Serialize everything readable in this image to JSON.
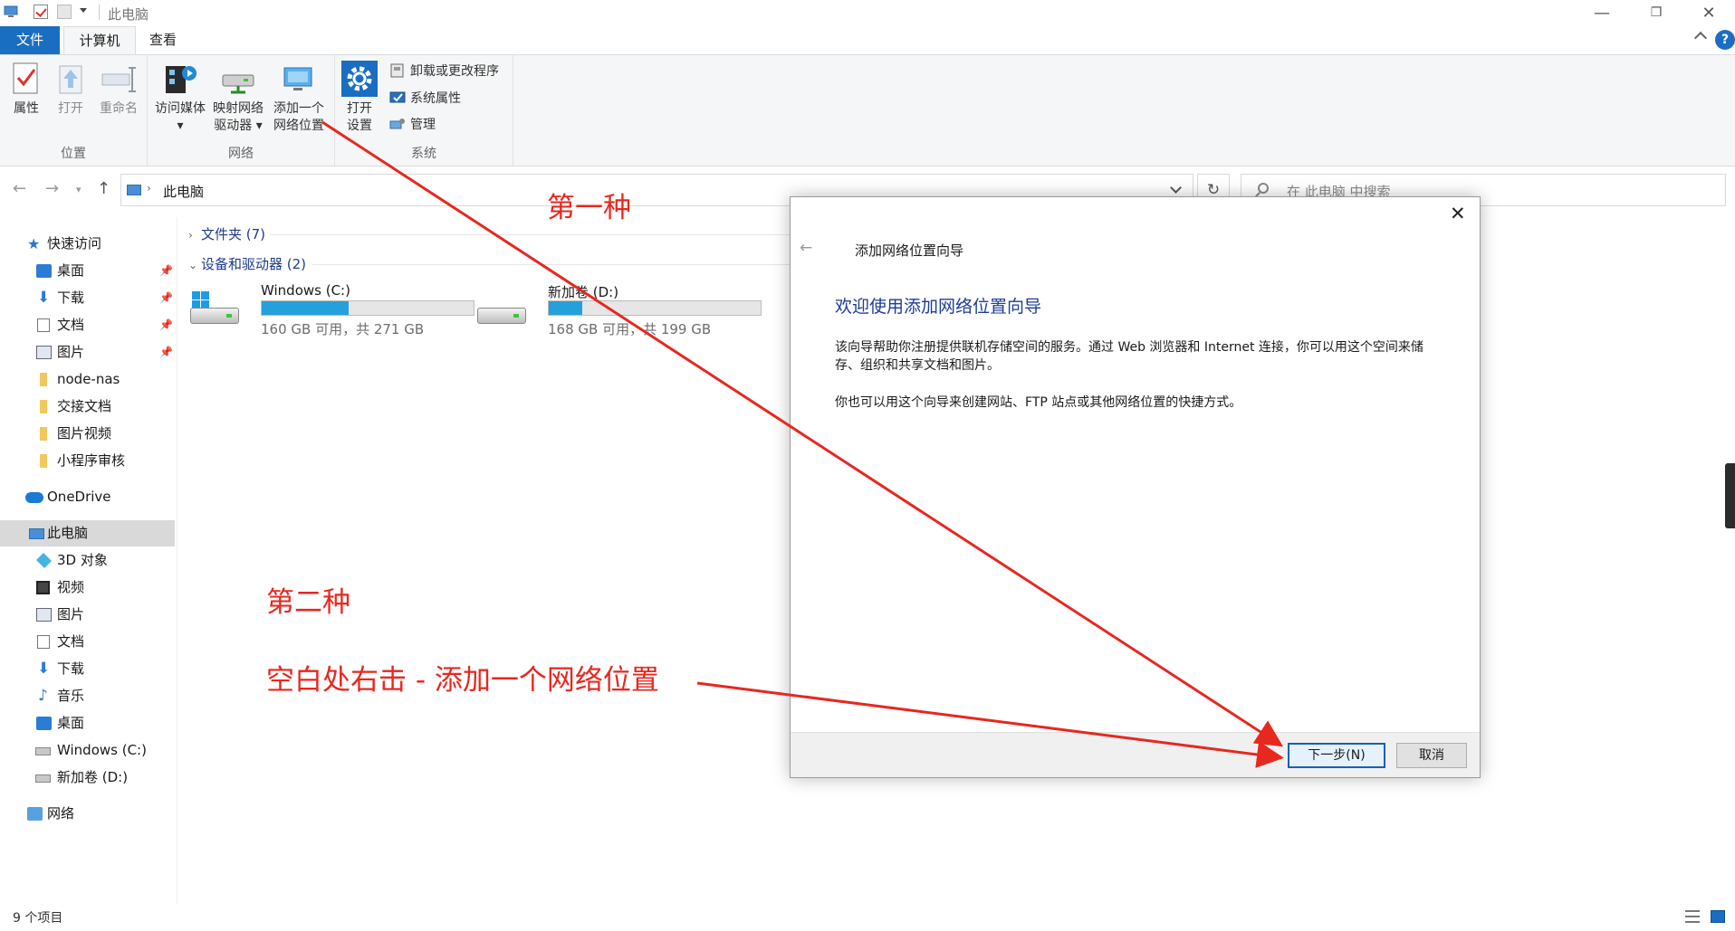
{
  "window": {
    "title": "此电脑",
    "controls": {
      "minimize": "—",
      "maximize": "❐",
      "close": "✕"
    }
  },
  "ribbon": {
    "tabs": [
      {
        "label": "文件",
        "active": false
      },
      {
        "label": "计算机",
        "active": true
      },
      {
        "label": "查看",
        "active": false
      }
    ],
    "help": "?",
    "groups": {
      "location": {
        "label": "位置",
        "buttons": {
          "properties": "属性",
          "open": "打开",
          "rename": "重命名"
        }
      },
      "network": {
        "label": "网络",
        "buttons": {
          "access_media": "访问媒体",
          "map_drive_line1": "映射网络",
          "map_drive_line2": "驱动器",
          "add_location_line1": "添加一个",
          "add_location_line2": "网络位置"
        }
      },
      "system": {
        "label": "系统",
        "buttons": {
          "open_settings_line1": "打开",
          "open_settings_line2": "设置",
          "uninstall": "卸载或更改程序",
          "system_properties": "系统属性",
          "manage": "管理"
        }
      }
    }
  },
  "address_bar": {
    "path": "此电脑",
    "refresh": "↻",
    "search_placeholder": "在 此电脑 中搜索"
  },
  "nav_pane": {
    "quick_access": "快速访问",
    "quick_items": [
      "桌面",
      "下载",
      "文档",
      "图片"
    ],
    "folders": [
      "node-nas",
      "交接文档",
      "图片视频",
      "小程序审核"
    ],
    "onedrive": "OneDrive",
    "this_pc": "此电脑",
    "pc_items": [
      "3D 对象",
      "视频",
      "图片",
      "文档",
      "下载",
      "音乐",
      "桌面",
      "Windows (C:)",
      "新加卷 (D:)"
    ],
    "network": "网络"
  },
  "content": {
    "folders_header": "文件夹 (7)",
    "devices_header": "设备和驱动器 (2)",
    "drives": [
      {
        "name": "Windows (C:)",
        "free": "160 GB 可用，共 271 GB",
        "used_fraction": 0.41
      },
      {
        "name": "新加卷 (D:)",
        "free": "168 GB 可用，共 199 GB",
        "used_fraction": 0.16
      }
    ]
  },
  "dialog": {
    "title": "添加网络位置向导",
    "heading": "欢迎使用添加网络位置向导",
    "para1": "该向导帮助你注册提供联机存储空间的服务。通过 Web 浏览器和 Internet 连接，你可以用这个空间来储存、组织和共享文档和图片。",
    "para2": "你也可以用这个向导来创建网站、FTP 站点或其他网络位置的快捷方式。",
    "next_button": "下一步(N)",
    "cancel_button": "取消",
    "close": "✕",
    "back": "←"
  },
  "annotations": {
    "first": "第一种",
    "second": "第二种",
    "second_desc": "空白处右击 - 添加一个网络位置",
    "color": "#e8271f"
  },
  "status_bar": {
    "item_count": "9 个项目"
  }
}
